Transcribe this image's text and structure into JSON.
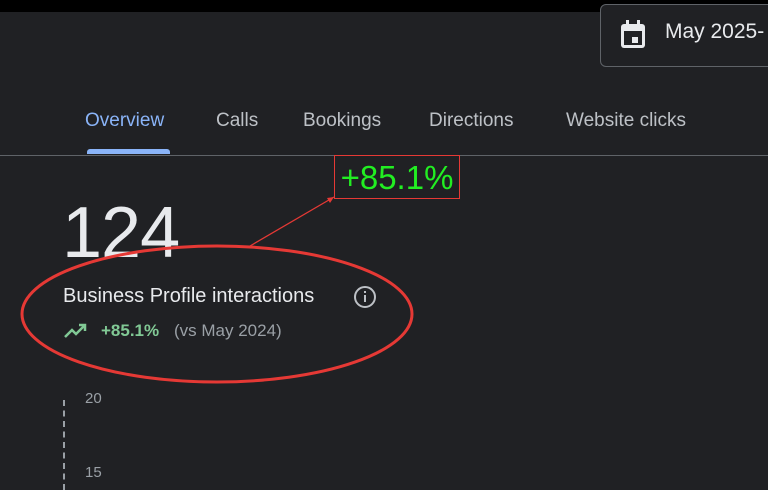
{
  "header": {
    "date_range": "May 2025-"
  },
  "tabs": [
    {
      "label": "Overview",
      "active": true
    },
    {
      "label": "Calls",
      "active": false
    },
    {
      "label": "Bookings",
      "active": false
    },
    {
      "label": "Directions",
      "active": false
    },
    {
      "label": "Website clicks",
      "active": false
    }
  ],
  "metric": {
    "value": "124",
    "label": "Business Profile interactions",
    "change": "+85.1%",
    "comparison": "(vs May 2024)"
  },
  "chart": {
    "y_ticks": [
      "20",
      "15"
    ]
  },
  "annotation": {
    "callout_text": "+85.1%",
    "highlight_color": "#e53935",
    "callout_text_color": "#22ee22"
  },
  "colors": {
    "background": "#202124",
    "accent": "#8ab4f8",
    "positive": "#81c995"
  }
}
